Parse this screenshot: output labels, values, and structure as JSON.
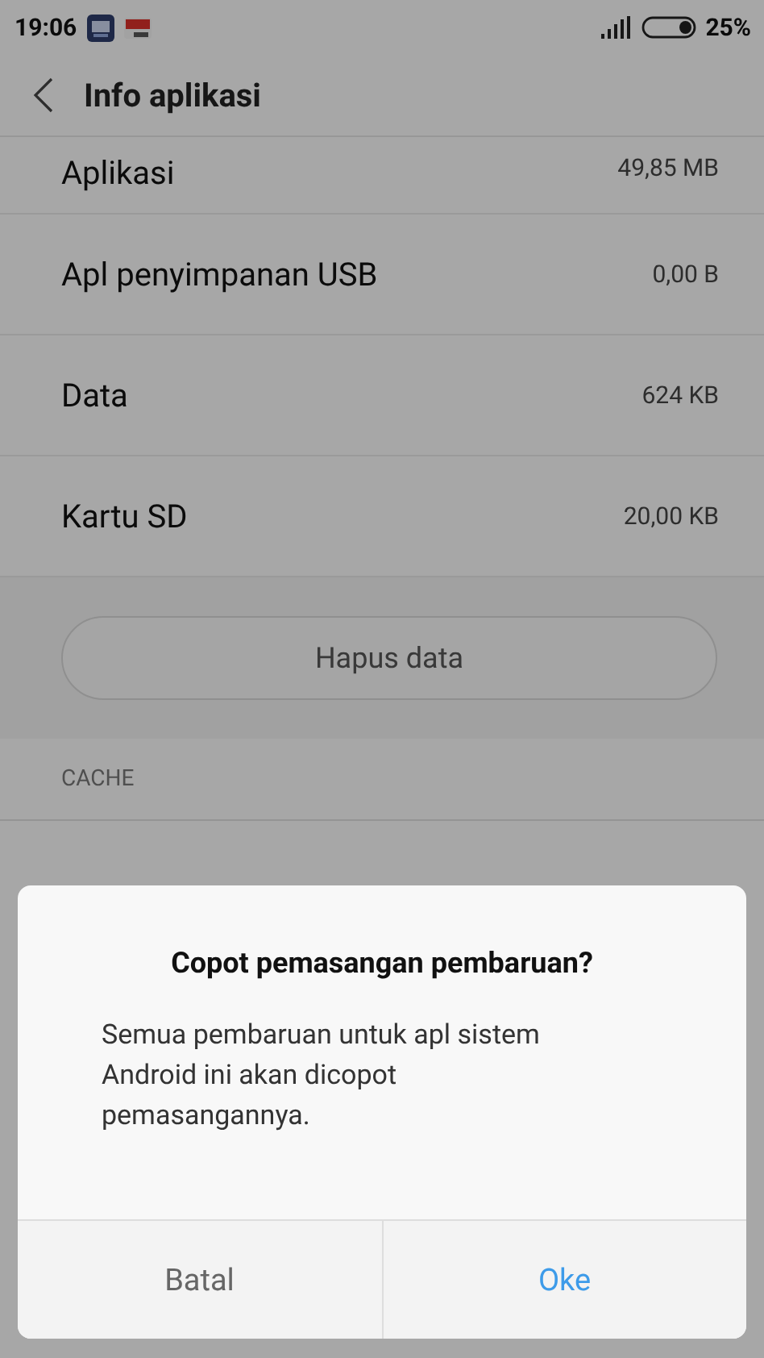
{
  "status_bar": {
    "time": "19:06",
    "battery_text": "25%"
  },
  "header": {
    "title": "Info aplikasi"
  },
  "storage_rows": [
    {
      "label": "Aplikasi",
      "value": "49,85 MB"
    },
    {
      "label": "Apl penyimpanan USB",
      "value": "0,00 B"
    },
    {
      "label": "Data",
      "value": "624 KB"
    },
    {
      "label": "Kartu SD",
      "value": "20,00 KB"
    }
  ],
  "clear_data_button": {
    "label": "Hapus data"
  },
  "cache_section": {
    "header": "CACHE"
  },
  "dialog": {
    "title": "Copot pemasangan pembaruan?",
    "message": "Semua pembaruan untuk apl sistem Android ini akan dicopot pemasangannya.",
    "buttons": [
      {
        "label": "Batal",
        "kind": "cancel"
      },
      {
        "label": "Oke",
        "kind": "confirm"
      }
    ]
  }
}
